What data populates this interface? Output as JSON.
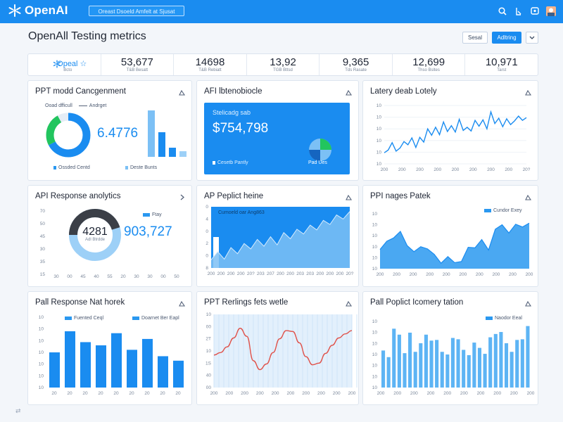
{
  "app": {
    "name": "OpenAI",
    "search_text": "Oreast Dsoeld Amfelt at Sjusat"
  },
  "header": {
    "title": "OpenAll Testing metrics",
    "btn_light": "Sesal",
    "btn_primary": "Adltring"
  },
  "kpis": [
    {
      "value": "Opeal ☆",
      "sub": "Bcto"
    },
    {
      "value": "53,677",
      "sub": "T&B Besatt"
    },
    {
      "value": "14698",
      "sub": "T&B Rebiatt"
    },
    {
      "value": "13,92",
      "sub": "TGB Bttsd"
    },
    {
      "value": "9,365",
      "sub": "Tds Rasate"
    },
    {
      "value": "12,699",
      "sub": "Thso Bsltes"
    },
    {
      "value": "10,971",
      "sub": "Tarst"
    }
  ],
  "cards": {
    "c1": {
      "title": "PPT modd Cancgenment",
      "legend_a": "Ooad dfficull",
      "legend_b": "Andrget",
      "big": "6.4776",
      "foot_a": "Ossded Centd",
      "foot_b": "Deste Bunts"
    },
    "c2": {
      "title": "AFI lbtenobiocle",
      "sub": "Stelicadg sab",
      "big": "$754,798",
      "foot": "Cesetb Pantly",
      "badge": "Pad Ues"
    },
    "c3": {
      "title": "Latery deab Lotely"
    },
    "c4": {
      "title": "API Response anolytics",
      "big_ring": "4281",
      "ring_sub": "Adl Btrdde",
      "legend": "Ftay",
      "big": "903,727"
    },
    "c5": {
      "title": "AP Peplict heine",
      "legend": "Cumoeld oar Ang863"
    },
    "c6": {
      "title": "PPI nages Patek",
      "legend": "Cundor Exey"
    },
    "c7": {
      "title": "Pall Response Nat horek",
      "legend_a": "Fuented Ceql",
      "legend_b": "Doarnet Ber Eapl"
    },
    "c8": {
      "title": "PPT Rerlings fets wetle"
    },
    "c9": {
      "title": "Pall Poplict Icomery tation",
      "legend": "Naodor Eeal"
    }
  },
  "colors": {
    "accent": "#1a8cf0",
    "chart_fill": "#7cc0f5",
    "red_line": "#e0524a",
    "green": "#22c55e"
  },
  "chart_data": [
    {
      "id": "latency-line",
      "type": "line",
      "x": [
        "200",
        "200",
        "200",
        "200",
        "200",
        "200",
        "200",
        "200",
        "20?"
      ],
      "y_ticks": [
        "10",
        "10",
        "10",
        "10",
        "10",
        "10"
      ],
      "values": [
        2.1,
        2.6,
        4.0,
        2.4,
        3.0,
        4.2,
        3.6,
        4.9,
        3.1,
        5.0,
        4.1,
        6.6,
        5.4,
        6.9,
        5.5,
        7.9,
        6.1,
        7.2,
        6.0,
        8.4,
        6.3,
        6.9,
        6.2,
        8.2,
        7.1,
        8.3,
        6.6,
        9.8,
        7.6,
        8.6,
        7.0,
        8.5,
        7.4,
        8.1,
        9.0,
        8.2,
        8.7
      ],
      "ylim": [
        0,
        11
      ]
    },
    {
      "id": "response-area",
      "type": "area",
      "x": [
        "200",
        "200",
        "200",
        "200",
        "20?",
        "203",
        "207",
        "200",
        "200",
        "203",
        "203",
        "200",
        "200",
        "200",
        "20?"
      ],
      "y_ticks": [
        "8",
        "0",
        "2",
        "0",
        "4",
        "0"
      ],
      "values": [
        1.2,
        2.4,
        1.3,
        3.0,
        2.1,
        3.6,
        2.8,
        4.2,
        3.2,
        4.6,
        3.4,
        5.2,
        4.3,
        5.7,
        5.0,
        6.3,
        5.6,
        7.0,
        6.4,
        7.8,
        7.2,
        8.3
      ],
      "ylim": [
        0,
        9
      ]
    },
    {
      "id": "pages-area",
      "type": "area",
      "x": [
        "200",
        "200",
        "200",
        "200",
        "200",
        "200",
        "200",
        "200",
        "200",
        "200"
      ],
      "y_ticks": [
        "10",
        "10",
        "10",
        "10",
        "10",
        "10"
      ],
      "values": [
        3.5,
        5.0,
        5.6,
        6.8,
        4.2,
        3.1,
        4.0,
        3.6,
        2.6,
        1.0,
        2.2,
        1.1,
        1.3,
        3.9,
        3.8,
        5.3,
        3.4,
        7.2,
        8.0,
        6.5,
        8.1,
        7.6,
        8.3
      ],
      "ylim": [
        0,
        10
      ]
    },
    {
      "id": "response-bars",
      "type": "bar",
      "categories": [
        "20",
        "20",
        "20",
        "20",
        "20",
        "20",
        "20",
        "20",
        "20"
      ],
      "y_ticks": [
        "10",
        "10",
        "10",
        "10",
        "10",
        "10",
        "10"
      ],
      "values": [
        5.5,
        8.8,
        7.1,
        6.6,
        8.5,
        5.9,
        7.6,
        4.9,
        4.2
      ],
      "ylim": [
        0,
        11
      ]
    },
    {
      "id": "ratings-line",
      "type": "line",
      "x": [
        "200",
        "200",
        "200",
        "200",
        "200",
        "200",
        "200",
        "200",
        "200",
        "200"
      ],
      "y_ticks": [
        "00",
        "40",
        "1S",
        "10",
        "2T",
        "00",
        "10"
      ],
      "values": [
        4.0,
        4.3,
        5.0,
        6.1,
        7.3,
        6.3,
        3.3,
        2.2,
        2.9,
        4.3,
        6.0,
        7.0,
        6.9,
        5.5,
        3.8,
        2.8,
        3.0,
        4.2,
        5.2,
        6.1,
        6.6,
        7.0
      ],
      "ylim": [
        0,
        9
      ]
    },
    {
      "id": "inventory-bars",
      "type": "bar",
      "categories": [
        "200",
        "200",
        "200",
        "200",
        "200",
        "200",
        "200",
        "200",
        "200",
        "200"
      ],
      "y_ticks": [
        "10",
        "10",
        "10",
        "10",
        "10",
        "10",
        "10"
      ],
      "values": [
        5.6,
        4.6,
        8.9,
        8.0,
        5.2,
        8.3,
        5.4,
        6.7,
        8.0,
        7.1,
        7.2,
        5.4,
        5.0,
        7.5,
        7.3,
        5.7,
        4.9,
        6.8,
        6.0,
        5.1,
        7.6,
        8.1,
        8.4,
        6.7,
        5.4,
        7.2,
        7.3,
        9.3
      ],
      "ylim": [
        0,
        10
      ]
    }
  ]
}
